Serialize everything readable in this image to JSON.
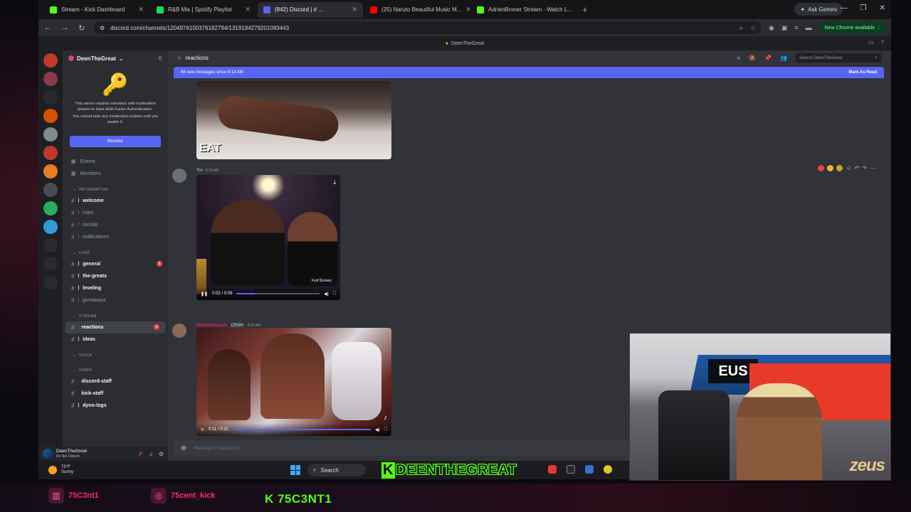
{
  "browser": {
    "tabs": [
      {
        "label": "Stream - Kick Dashboard",
        "color": "#53fc18",
        "active": false
      },
      {
        "label": "R&B Mix | Spotify Playlist",
        "color": "#1ed760",
        "active": false
      },
      {
        "label": "(842) Discord | # ...",
        "color": "#5865f2",
        "active": true
      },
      {
        "label": "(25) Naruto Beautiful Music M...",
        "color": "#ff0000",
        "active": false
      },
      {
        "label": "AdrienBroner Stream - Watch L...",
        "color": "#53fc18",
        "active": false
      }
    ],
    "new_tab": "+",
    "gemini_label": "Ask Gemini",
    "url": "discord.com/channels/1204976100376182794/1319194279201083443",
    "update_label": "New Chrome available"
  },
  "discord": {
    "window_title": "DeenTheGreat",
    "server_name": "DeenTheGreat",
    "mfa_notice_1": "This server requires members with moderation powers to have Multi-Factor Authentication.",
    "mfa_notice_2": "You cannot take any moderation actions until you enable it.",
    "resolve_label": "Resolve",
    "nav_links": [
      {
        "label": "Events",
        "icon": "calendar-icon"
      },
      {
        "label": "Members",
        "icon": "members-icon"
      }
    ],
    "categories": [
      {
        "name": "INFORMATION",
        "channels": [
          {
            "label": "welcome",
            "emoji": "👋",
            "unread": true,
            "mention": ""
          },
          {
            "label": "rules",
            "emoji": "📜",
            "unread": false,
            "mention": ""
          },
          {
            "label": "socials",
            "emoji": "📢",
            "unread": false,
            "mention": ""
          },
          {
            "label": "notifications",
            "emoji": "🔔",
            "unread": false,
            "mention": ""
          }
        ]
      },
      {
        "name": "CHAT",
        "channels": [
          {
            "label": "general",
            "emoji": "💬",
            "unread": true,
            "mention": "1"
          },
          {
            "label": "the-greats",
            "emoji": "👑",
            "unread": true,
            "mention": ""
          },
          {
            "label": "leveling",
            "emoji": "📈",
            "unread": true,
            "mention": ""
          },
          {
            "label": "giveaways",
            "emoji": "🎁",
            "unread": false,
            "mention": ""
          }
        ]
      },
      {
        "name": "STREAM",
        "channels": [
          {
            "label": "reactions",
            "emoji": "",
            "unread": true,
            "mention": "1",
            "selected": true
          },
          {
            "label": "ideas",
            "emoji": "💡",
            "unread": true,
            "mention": ""
          }
        ]
      },
      {
        "name": "VOICE",
        "channels": []
      },
      {
        "name": "STAFF",
        "channels": [
          {
            "label": "discord-staff",
            "emoji": "",
            "unread": true,
            "mention": ""
          },
          {
            "label": "kick-staff",
            "emoji": "",
            "unread": true,
            "mention": ""
          },
          {
            "label": "dyno-logs",
            "emoji": "🔍",
            "unread": true,
            "mention": ""
          }
        ]
      }
    ],
    "user": {
      "name": "DeenTheGreat",
      "status": "Do Not Disturb"
    },
    "channel_name": "reactions",
    "search_placeholder": "Search DeenTheGreat",
    "new_messages_text": "66 new messages since 9:13 AM",
    "mark_read": "Mark As Read",
    "video1_caption": "EAT",
    "msg2": {
      "author": "Tre",
      "time": "8:25 AM",
      "time_display": "0:02 / 0:09",
      "tooltip": "Full Screen",
      "progress": 0.22
    },
    "msg3": {
      "author": "Helloimthesam",
      "tag": "CRSH",
      "time": "8:26 AM",
      "time_display": "0:11 / 0:11",
      "progress": 1.0
    },
    "composer_placeholder": "Message # | reactions"
  },
  "taskbar": {
    "weather_temp": "79°F",
    "weather_desc": "Sunny",
    "search_label": "Search",
    "kick_banner": "DEENTHEGREAT",
    "kick_k": "K"
  },
  "overlay": {
    "twitch_handle": "75C3nt1",
    "instagram_handle": "75cent_kick",
    "kick_handle": "K 75C3NT1",
    "webcam_brand": "zeus",
    "ring_text_a": "EUS",
    "ring_text_b": "zeus"
  }
}
